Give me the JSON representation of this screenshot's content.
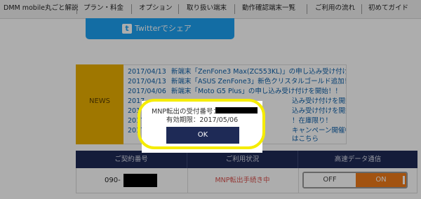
{
  "nav": {
    "items": [
      "DMM mobile丸ごと解説",
      "プラン・料金",
      "オプション",
      "取り扱い端末",
      "動作確認端末一覧",
      "ご利用の流れ",
      "初めてガイド"
    ]
  },
  "twitter": {
    "icon": "twitter-icon",
    "label": "Twitterでシェア"
  },
  "news": {
    "label": "NEWS",
    "items": [
      {
        "date": "2017/04/13",
        "text": "新端末「ZenFone3 Max(ZC553KL)」の申し込み受け付けを開始！！"
      },
      {
        "date": "2017/04/13",
        "text": "新端末「ASUS ZenFone3」新色クリスタルゴールド追加！！"
      },
      {
        "date": "2017/04/06",
        "text": "新端末「Moto G5 Plus」の申し込み受け付けを開始！！"
      },
      {
        "date": "2017",
        "text": "込み受け付けを開始！！"
      },
      {
        "date": "2017",
        "text": "込み受け付けを開始！！"
      },
      {
        "date": "2017",
        "text": "！在庫限り！"
      },
      {
        "date": "2017",
        "text": "キャンペーン開催中！！"
      },
      {
        "date": "",
        "text": "はこちら"
      }
    ]
  },
  "table": {
    "headers": [
      "ご契約番号",
      "ご利用状況",
      "高速データ通信"
    ],
    "row": {
      "phone_prefix": "090-",
      "status": "MNP転出手続き中",
      "toggle_off": "OFF",
      "toggle_on": "ON"
    }
  },
  "modal": {
    "line1_label": "MNP転出の受付番号：",
    "line2": "有効期限：2017/05/06",
    "ok_label": "OK"
  },
  "colors": {
    "accent": "#1e2a56",
    "news": "#ebb000",
    "highlight": "#f5ec00",
    "toggle_on": "#ef7b1a",
    "twitter": "#1da1f2"
  }
}
